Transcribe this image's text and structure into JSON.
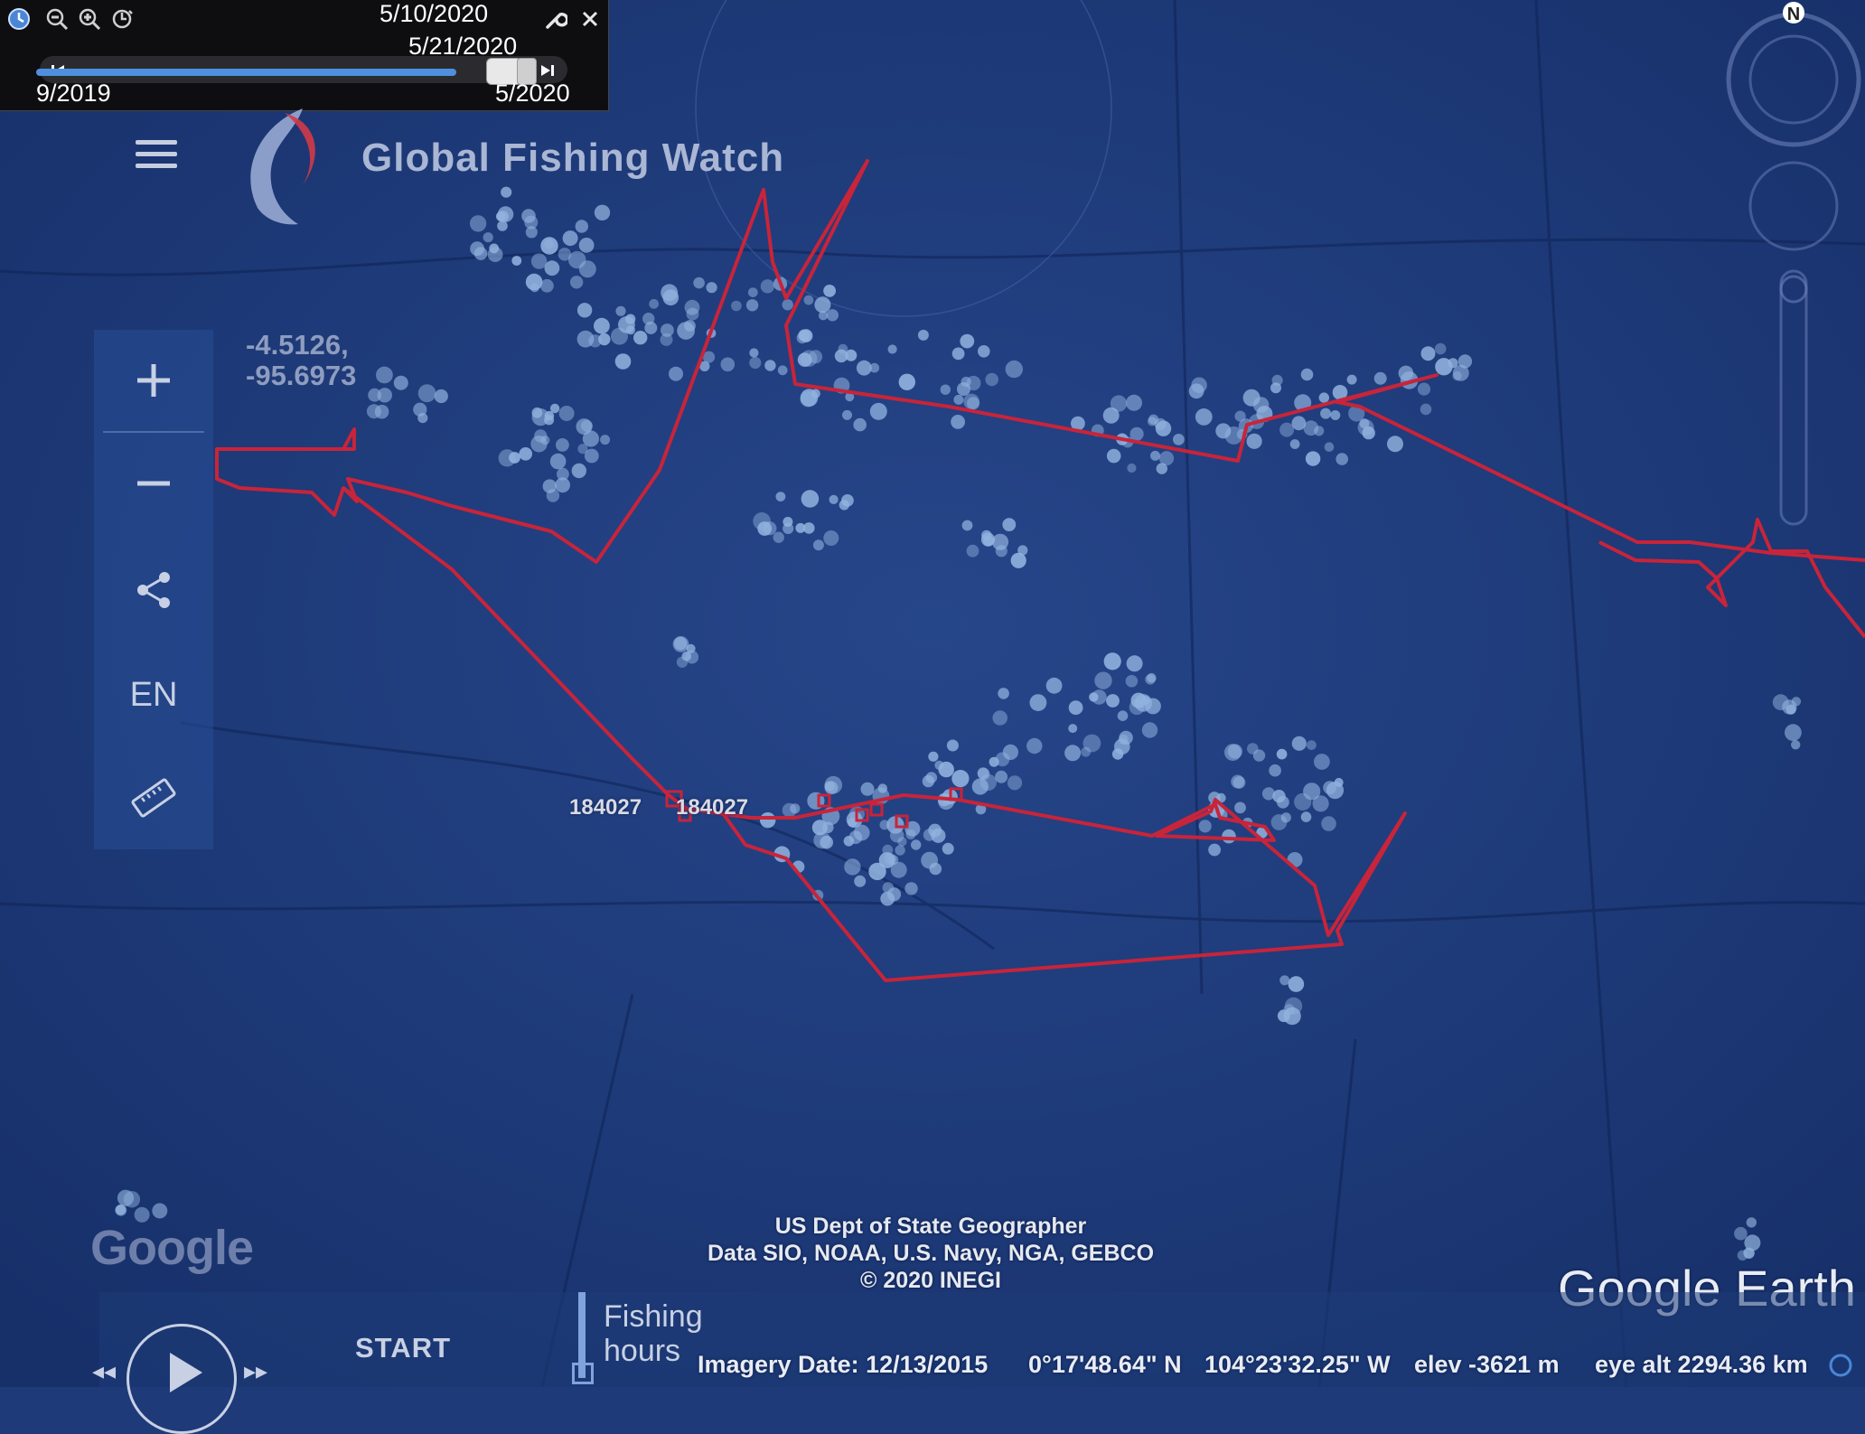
{
  "time_slider": {
    "range_start_date": "5/10/2020",
    "current_date": "5/21/2020",
    "timeline_left_label": "9/2019",
    "timeline_right_label": "5/2020",
    "progress": 0.93
  },
  "header": {
    "title": "Global Fishing Watch"
  },
  "tools": {
    "zoom_in": "+",
    "zoom_out": "−",
    "language": "EN"
  },
  "cursor_coords": {
    "line1": "-4.5126,",
    "line2": "-95.6973"
  },
  "vessel_labels": [
    "184027",
    "184027"
  ],
  "attribution": {
    "line1": "US Dept of State Geographer",
    "line2": "Data SIO, NOAA, U.S. Navy, NGA, GEBCO",
    "line3": "© 2020 INEGI"
  },
  "logos": {
    "google": "Google",
    "google_earth": "Google Earth"
  },
  "playback": {
    "start_label": "START",
    "layer_label_1": "Fishing",
    "layer_label_2": "hours"
  },
  "status_bar": {
    "imagery_date": "Imagery Date: 12/13/2015",
    "latitude": "0°17'48.64\" N",
    "longitude": "104°23'32.25\" W",
    "elevation": "elev -3621 m",
    "eye_alt": "eye alt 2294.36 km"
  },
  "compass": {
    "north_label": "N"
  },
  "colors": {
    "ocean": "#1f3a78",
    "track": "#c8243a",
    "fishing_dots": "#a6c8f0"
  }
}
